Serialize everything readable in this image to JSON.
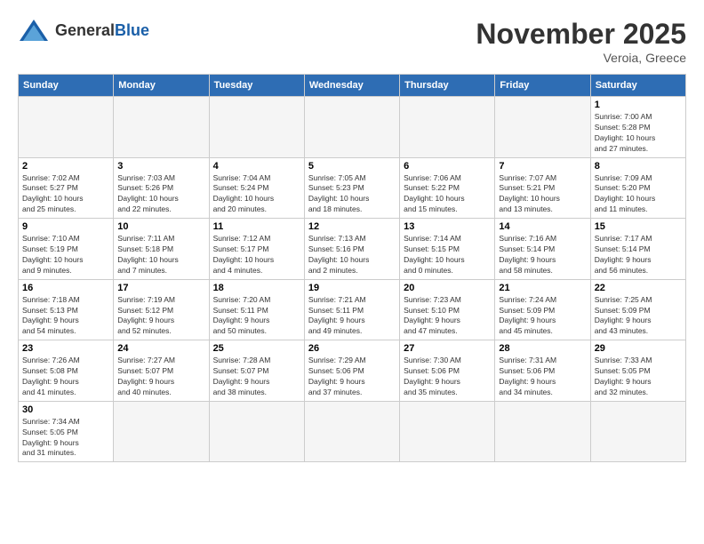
{
  "header": {
    "logo_general": "General",
    "logo_blue": "Blue",
    "month_title": "November 2025",
    "subtitle": "Veroia, Greece"
  },
  "days_of_week": [
    "Sunday",
    "Monday",
    "Tuesday",
    "Wednesday",
    "Thursday",
    "Friday",
    "Saturday"
  ],
  "weeks": [
    [
      {
        "day": "",
        "info": ""
      },
      {
        "day": "",
        "info": ""
      },
      {
        "day": "",
        "info": ""
      },
      {
        "day": "",
        "info": ""
      },
      {
        "day": "",
        "info": ""
      },
      {
        "day": "",
        "info": ""
      },
      {
        "day": "1",
        "info": "Sunrise: 7:00 AM\nSunset: 5:28 PM\nDaylight: 10 hours\nand 27 minutes."
      }
    ],
    [
      {
        "day": "2",
        "info": "Sunrise: 7:02 AM\nSunset: 5:27 PM\nDaylight: 10 hours\nand 25 minutes."
      },
      {
        "day": "3",
        "info": "Sunrise: 7:03 AM\nSunset: 5:26 PM\nDaylight: 10 hours\nand 22 minutes."
      },
      {
        "day": "4",
        "info": "Sunrise: 7:04 AM\nSunset: 5:24 PM\nDaylight: 10 hours\nand 20 minutes."
      },
      {
        "day": "5",
        "info": "Sunrise: 7:05 AM\nSunset: 5:23 PM\nDaylight: 10 hours\nand 18 minutes."
      },
      {
        "day": "6",
        "info": "Sunrise: 7:06 AM\nSunset: 5:22 PM\nDaylight: 10 hours\nand 15 minutes."
      },
      {
        "day": "7",
        "info": "Sunrise: 7:07 AM\nSunset: 5:21 PM\nDaylight: 10 hours\nand 13 minutes."
      },
      {
        "day": "8",
        "info": "Sunrise: 7:09 AM\nSunset: 5:20 PM\nDaylight: 10 hours\nand 11 minutes."
      }
    ],
    [
      {
        "day": "9",
        "info": "Sunrise: 7:10 AM\nSunset: 5:19 PM\nDaylight: 10 hours\nand 9 minutes."
      },
      {
        "day": "10",
        "info": "Sunrise: 7:11 AM\nSunset: 5:18 PM\nDaylight: 10 hours\nand 7 minutes."
      },
      {
        "day": "11",
        "info": "Sunrise: 7:12 AM\nSunset: 5:17 PM\nDaylight: 10 hours\nand 4 minutes."
      },
      {
        "day": "12",
        "info": "Sunrise: 7:13 AM\nSunset: 5:16 PM\nDaylight: 10 hours\nand 2 minutes."
      },
      {
        "day": "13",
        "info": "Sunrise: 7:14 AM\nSunset: 5:15 PM\nDaylight: 10 hours\nand 0 minutes."
      },
      {
        "day": "14",
        "info": "Sunrise: 7:16 AM\nSunset: 5:14 PM\nDaylight: 9 hours\nand 58 minutes."
      },
      {
        "day": "15",
        "info": "Sunrise: 7:17 AM\nSunset: 5:14 PM\nDaylight: 9 hours\nand 56 minutes."
      }
    ],
    [
      {
        "day": "16",
        "info": "Sunrise: 7:18 AM\nSunset: 5:13 PM\nDaylight: 9 hours\nand 54 minutes."
      },
      {
        "day": "17",
        "info": "Sunrise: 7:19 AM\nSunset: 5:12 PM\nDaylight: 9 hours\nand 52 minutes."
      },
      {
        "day": "18",
        "info": "Sunrise: 7:20 AM\nSunset: 5:11 PM\nDaylight: 9 hours\nand 50 minutes."
      },
      {
        "day": "19",
        "info": "Sunrise: 7:21 AM\nSunset: 5:11 PM\nDaylight: 9 hours\nand 49 minutes."
      },
      {
        "day": "20",
        "info": "Sunrise: 7:23 AM\nSunset: 5:10 PM\nDaylight: 9 hours\nand 47 minutes."
      },
      {
        "day": "21",
        "info": "Sunrise: 7:24 AM\nSunset: 5:09 PM\nDaylight: 9 hours\nand 45 minutes."
      },
      {
        "day": "22",
        "info": "Sunrise: 7:25 AM\nSunset: 5:09 PM\nDaylight: 9 hours\nand 43 minutes."
      }
    ],
    [
      {
        "day": "23",
        "info": "Sunrise: 7:26 AM\nSunset: 5:08 PM\nDaylight: 9 hours\nand 41 minutes."
      },
      {
        "day": "24",
        "info": "Sunrise: 7:27 AM\nSunset: 5:07 PM\nDaylight: 9 hours\nand 40 minutes."
      },
      {
        "day": "25",
        "info": "Sunrise: 7:28 AM\nSunset: 5:07 PM\nDaylight: 9 hours\nand 38 minutes."
      },
      {
        "day": "26",
        "info": "Sunrise: 7:29 AM\nSunset: 5:06 PM\nDaylight: 9 hours\nand 37 minutes."
      },
      {
        "day": "27",
        "info": "Sunrise: 7:30 AM\nSunset: 5:06 PM\nDaylight: 9 hours\nand 35 minutes."
      },
      {
        "day": "28",
        "info": "Sunrise: 7:31 AM\nSunset: 5:06 PM\nDaylight: 9 hours\nand 34 minutes."
      },
      {
        "day": "29",
        "info": "Sunrise: 7:33 AM\nSunset: 5:05 PM\nDaylight: 9 hours\nand 32 minutes."
      }
    ],
    [
      {
        "day": "30",
        "info": "Sunrise: 7:34 AM\nSunset: 5:05 PM\nDaylight: 9 hours\nand 31 minutes."
      },
      {
        "day": "",
        "info": ""
      },
      {
        "day": "",
        "info": ""
      },
      {
        "day": "",
        "info": ""
      },
      {
        "day": "",
        "info": ""
      },
      {
        "day": "",
        "info": ""
      },
      {
        "day": "",
        "info": ""
      }
    ]
  ]
}
